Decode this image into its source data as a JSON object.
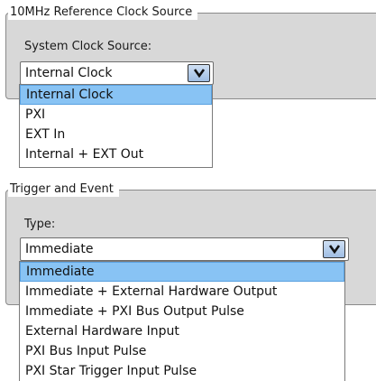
{
  "clock_group": {
    "title": "10MHz Reference Clock Source",
    "field_label": "System Clock Source:",
    "selected_value": "Internal Clock",
    "options": [
      "Internal Clock",
      "PXI",
      "EXT In",
      "Internal + EXT Out"
    ],
    "selected_index": 0
  },
  "trigger_group": {
    "title": "Trigger and Event",
    "field_label": "Type:",
    "selected_value": "Immediate",
    "options": [
      "Immediate",
      "Immediate + External Hardware Output",
      "Immediate + PXI Bus Output Pulse",
      "External Hardware Input",
      "PXI Bus Input Pulse",
      "PXI Star Trigger Input Pulse"
    ],
    "selected_index": 0
  },
  "icons": {
    "dropdown_arrow": "chevron-down-icon"
  },
  "colors": {
    "highlight": "#88c3f4",
    "panel": "#d8d8d8",
    "button": "#9fbde3"
  }
}
